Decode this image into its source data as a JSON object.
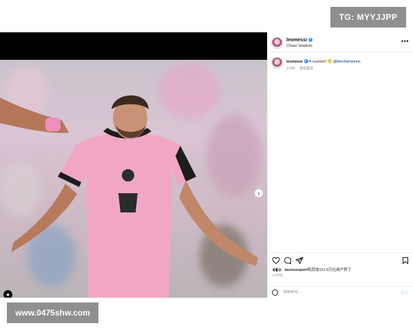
{
  "watermarks": {
    "top_right": "TG: MYYJJPP",
    "bottom_left": "www.0475shw.com"
  },
  "post": {
    "header": {
      "username": "leomessi",
      "location": "Chase Stadium",
      "more_icon": "more-horizontal-icon"
    },
    "caption": {
      "username": "leomessi",
      "text": "A cuartos!!",
      "mention": "@thechampions",
      "time": "2小时",
      "translate": "查看翻译"
    },
    "likes_line": {
      "username": "laureussport",
      "text": "和其他163.9万位用户赞了"
    },
    "timestamp": "2小时前",
    "comment_box": {
      "placeholder": "添加评论...",
      "post_label": "发布"
    }
  },
  "icons": {
    "like": "heart-icon",
    "comment": "comment-icon",
    "share": "share-icon",
    "save": "bookmark-icon",
    "emoji": "smile-icon",
    "next": "chevron-right-icon",
    "tags": "user-tag-icon"
  },
  "colors": {
    "jersey_pink": "#f2a6c6",
    "verified_blue": "#3897f0",
    "mention_blue": "#00376b",
    "watermark_gray": "#8f8f8f"
  }
}
